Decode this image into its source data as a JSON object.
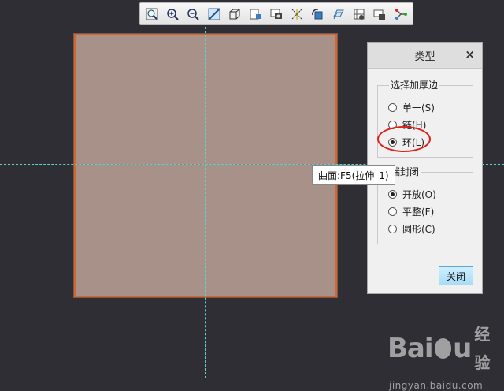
{
  "toolbar": {
    "buttons": [
      {
        "icon": "zoom-fit-icon"
      },
      {
        "icon": "zoom-in-icon"
      },
      {
        "icon": "zoom-out-icon"
      },
      {
        "icon": "repaint-icon"
      },
      {
        "icon": "display-style-icon"
      },
      {
        "icon": "saved-views-icon"
      },
      {
        "icon": "view-manager-icon"
      },
      {
        "icon": "datum-display-icon"
      },
      {
        "icon": "spin-center-icon"
      },
      {
        "icon": "annotation-icon"
      },
      {
        "icon": "section-view-icon"
      },
      {
        "icon": "layer-icon"
      },
      {
        "icon": "appearance-icon"
      }
    ]
  },
  "viewport": {
    "tooltip": "曲面:F5(拉伸_1)"
  },
  "dialog": {
    "title": "类型",
    "close_glyph": "×",
    "group1": {
      "legend": "选择加厚边",
      "options": [
        "单一(S)",
        "链(H)",
        "环(L)"
      ],
      "selected": "环(L)"
    },
    "group2": {
      "legend": "端封闭",
      "options": [
        "开放(O)",
        "平整(F)",
        "圆形(C)"
      ],
      "selected": "开放(O)"
    },
    "close_button": "关闭"
  },
  "watermark": {
    "logo_left": "Bai",
    "logo_right": "u",
    "logo_cn": "经验",
    "url": "jingyan.baidu.com"
  },
  "colors": {
    "background": "#2e2e34",
    "surface": "#a89189",
    "surface_edge": "#d5672e",
    "datum": "#5fd2c8",
    "highlight": "#e0201c",
    "button": "#a8dcf6"
  }
}
